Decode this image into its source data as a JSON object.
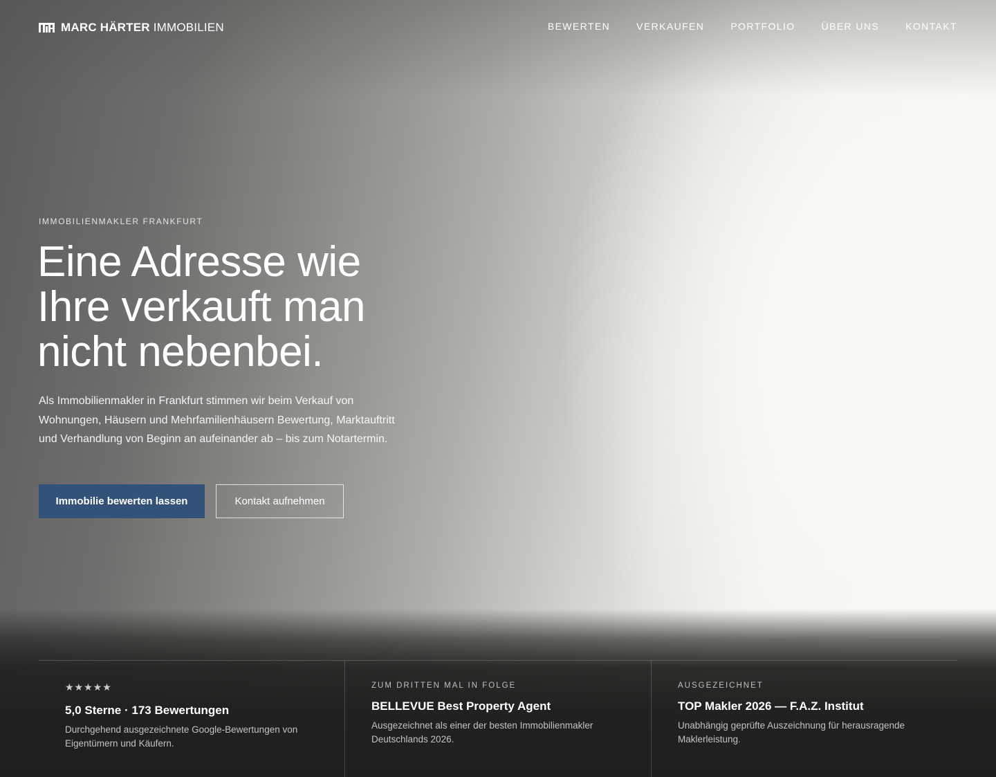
{
  "header": {
    "logo_bold": "MARC HÄRTER",
    "logo_light": "IMMOBILIEN",
    "nav": [
      "BEWERTEN",
      "VERKAUFEN",
      "PORTFOLIO",
      "ÜBER UNS",
      "KONTAKT"
    ]
  },
  "hero": {
    "eyebrow": "IMMOBILIENMAKLER FRANKFURT",
    "headline_lines": [
      "Eine Adresse wie",
      "Ihre verkauft man",
      "nicht nebenbei."
    ],
    "intro": "Als Immobilienmakler in Frankfurt stimmen wir beim Verkauf von Wohnungen, Häusern und Mehrfamilienhäusern Bewertung, Marktauftritt und Verhandlung von Beginn an aufeinander ab – bis zum Notartermin.",
    "primary_cta": "Immobilie bewerten lassen",
    "secondary_cta": "Kontakt aufnehmen"
  },
  "awards": [
    {
      "stars": "★★★★★",
      "rating": 5,
      "title": "5,0 Sterne · 173 Bewertungen",
      "description": "Durchgehend ausgezeichnete Google-Bewertungen von Eigentümern und Käufern."
    },
    {
      "eyebrow": "ZUM DRITTEN MAL IN FOLGE",
      "title": "BELLEVUE Best Property Agent",
      "description": "Ausgezeichnet als einer der besten Immobilienmakler Deutschlands 2026."
    },
    {
      "eyebrow": "AUSGEZEICHNET",
      "title": "TOP Makler 2026 — F.A.Z. Institut",
      "description": "Unabhängig geprüfte Auszeichnung für herausragende Maklerleistung."
    }
  ],
  "colors": {
    "primary_button": "#33527a",
    "footer_dark": "#21211f",
    "hero_light": "#f8f6f1"
  },
  "icons": {
    "logo_mark": "mh-monogram-icon",
    "rating": "star-icon"
  }
}
